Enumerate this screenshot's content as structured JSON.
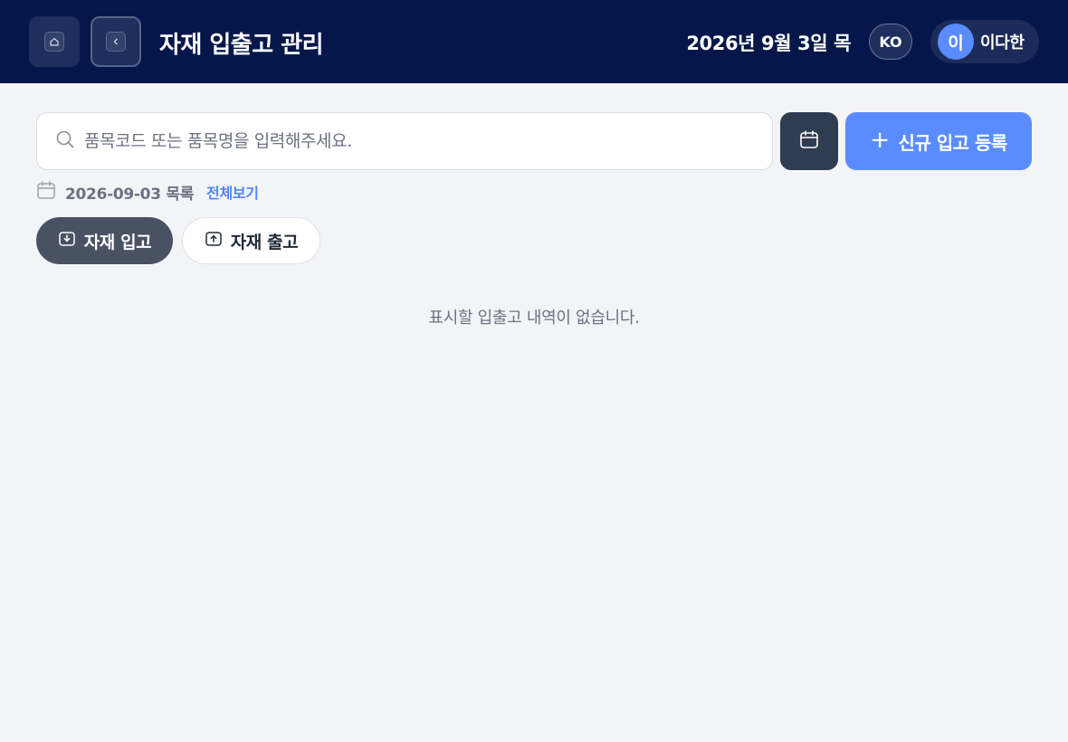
{
  "header": {
    "title": "자재 입출고 관리",
    "date": "2026년 9월 3일 목",
    "language": "KO",
    "user": {
      "initial": "이",
      "name": "이다한"
    },
    "icons": {
      "home": "home-icon",
      "back": "chevron-left-icon"
    }
  },
  "search": {
    "placeholder": "품목코드 또는 품목명을 입력해주세요.",
    "value": ""
  },
  "toolbar": {
    "calendar_icon": "calendar-icon",
    "new_receipt_label": "신규 입고 등록"
  },
  "list": {
    "date_label": "2026-09-03 목록",
    "view_all_label": "전체보기"
  },
  "tabs": [
    {
      "label": "자재 입고",
      "icon": "download-tray-icon",
      "active": true
    },
    {
      "label": "자재 출고",
      "icon": "upload-tray-icon",
      "active": false
    }
  ],
  "empty_message": "표시할 입출고 내역이 없습니다.",
  "colors": {
    "header_bg": "#05174a",
    "accent": "#5b8cff",
    "active_tab": "#495263",
    "page_bg": "#f2f4f8"
  }
}
